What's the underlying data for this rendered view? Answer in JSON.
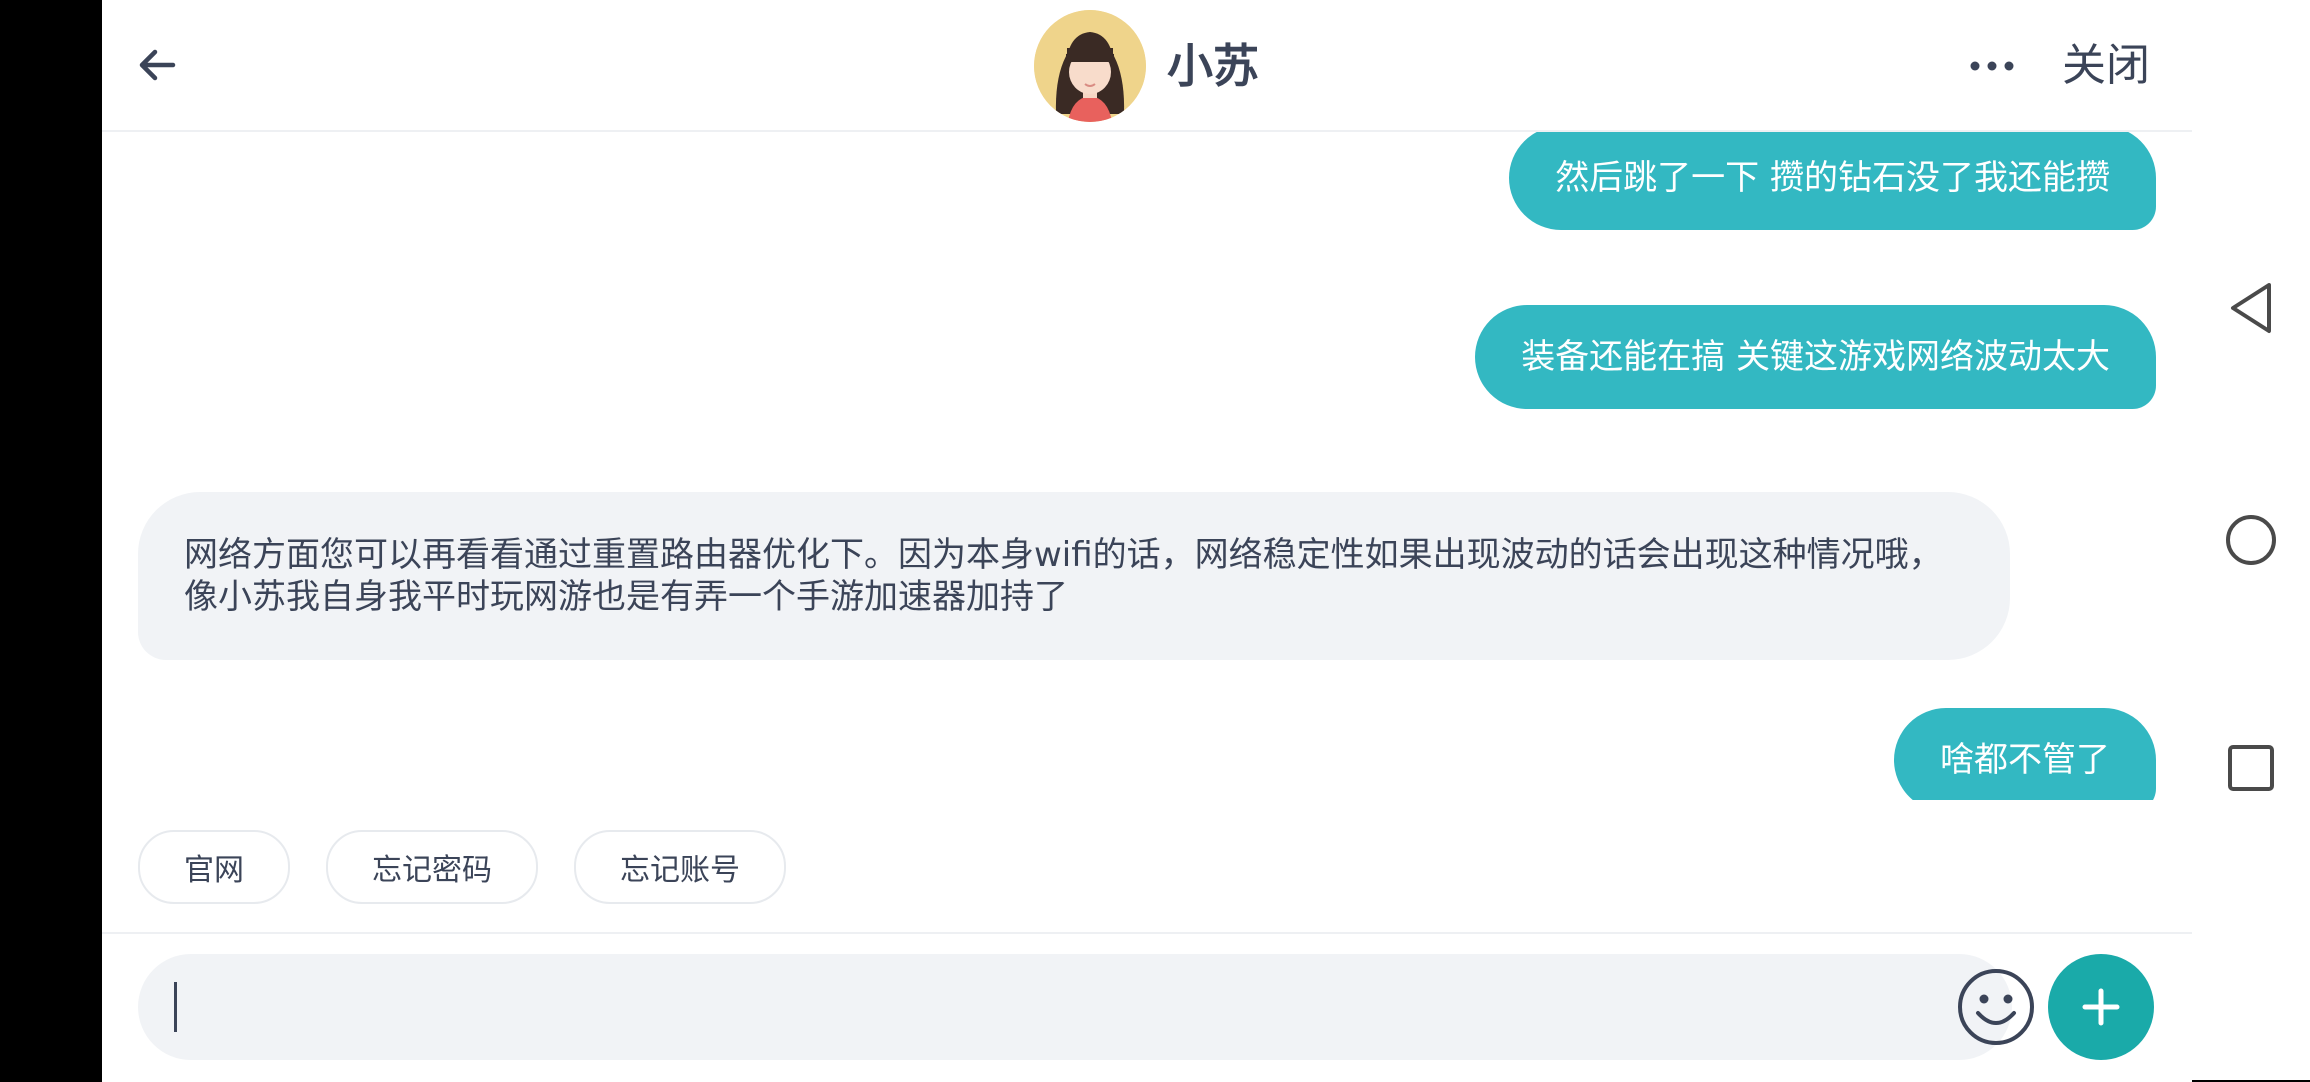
{
  "header": {
    "title": "小苏",
    "close_label": "关闭",
    "icons": {
      "back": "back-arrow-icon",
      "more": "more-dots-icon"
    }
  },
  "messages": [
    {
      "sender": "user",
      "text": "然后跳了一下 攒的钻石没了我还能攒"
    },
    {
      "sender": "user",
      "text": "装备还能在搞 关键这游戏网络波动太大"
    },
    {
      "sender": "agent",
      "text": "网络方面您可以再看看通过重置路由器优化下。因为本身wifi的话，网络稳定性如果出现波动的话会出现这种情况哦，像小苏我自身我平时玩网游也是有弄一个手游加速器加持了"
    },
    {
      "sender": "user",
      "text": "啥都不管了"
    }
  ],
  "quick_replies": [
    "官网",
    "忘记密码",
    "忘记账号"
  ],
  "input": {
    "value": "",
    "placeholder": ""
  },
  "colors": {
    "accent": "#33b8c2",
    "plus_button": "#1aaaa9",
    "agent_bubble": "#f1f3f6",
    "text": "#3b4458"
  },
  "system_nav": {
    "icons": [
      "back-triangle-icon",
      "home-circle-icon",
      "recents-square-icon"
    ]
  }
}
